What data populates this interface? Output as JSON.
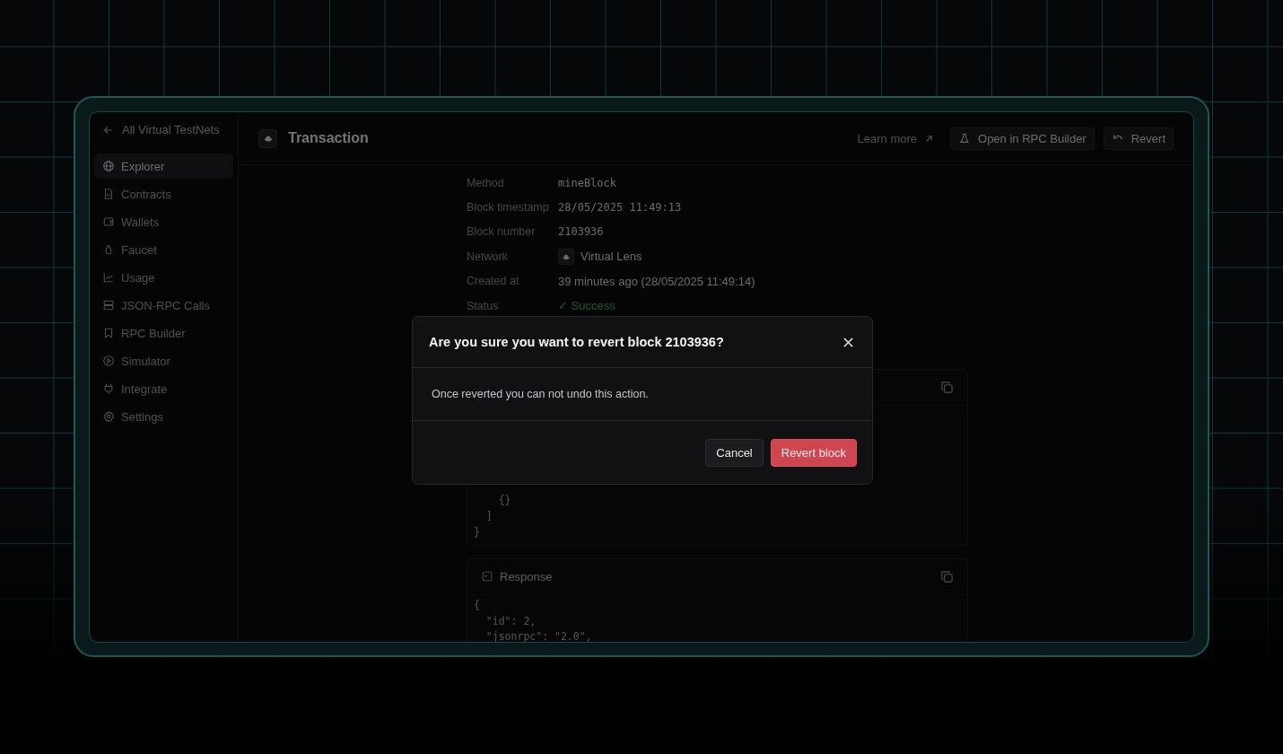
{
  "back_link": {
    "label": "All Virtual TestNets"
  },
  "sidebar": {
    "items": [
      {
        "label": "Explorer",
        "selected": true
      },
      {
        "label": "Contracts",
        "selected": false
      },
      {
        "label": "Wallets",
        "selected": false
      },
      {
        "label": "Faucet",
        "selected": false
      },
      {
        "label": "Usage",
        "selected": false
      },
      {
        "label": "JSON-RPC Calls",
        "selected": false
      },
      {
        "label": "RPC Builder",
        "selected": false
      },
      {
        "label": "Simulator",
        "selected": false
      },
      {
        "label": "Integrate",
        "selected": false
      },
      {
        "label": "Settings",
        "selected": false
      }
    ]
  },
  "header": {
    "title": "Transaction",
    "learn_more": "Learn more",
    "buttons": [
      {
        "label": "Open in RPC Builder"
      },
      {
        "label": "Revert"
      }
    ]
  },
  "details": [
    {
      "label": "Method",
      "value": "mineBlock",
      "kind": "mono"
    },
    {
      "label": "Block timestamp",
      "value": "28/05/2025 11:49:13",
      "kind": "mono"
    },
    {
      "label": "Block number",
      "value": "2103936",
      "kind": "mono"
    },
    {
      "label": "Network",
      "value": "Virtual Lens",
      "kind": "network"
    },
    {
      "label": "Created at",
      "value": "39 minutes ago (28/05/2025 11:49:14)",
      "kind": "text"
    },
    {
      "label": "Status",
      "value": "✓ Success",
      "kind": "status"
    }
  ],
  "request_panel": {
    "code_lines": [
      "    {}",
      "  ]",
      "}"
    ]
  },
  "response_panel": {
    "title": "Response",
    "code_lines": [
      "{",
      "  \"id\": 2,",
      "  \"jsonrpc\": \"2.0\","
    ]
  },
  "dialog": {
    "title": "Are you sure you want to revert block 2103936?",
    "message": "Once reverted you can not undo this action.",
    "buttons": [
      {
        "label": "Cancel",
        "kind": "secondary"
      },
      {
        "label": "Revert block",
        "kind": "danger"
      }
    ]
  }
}
